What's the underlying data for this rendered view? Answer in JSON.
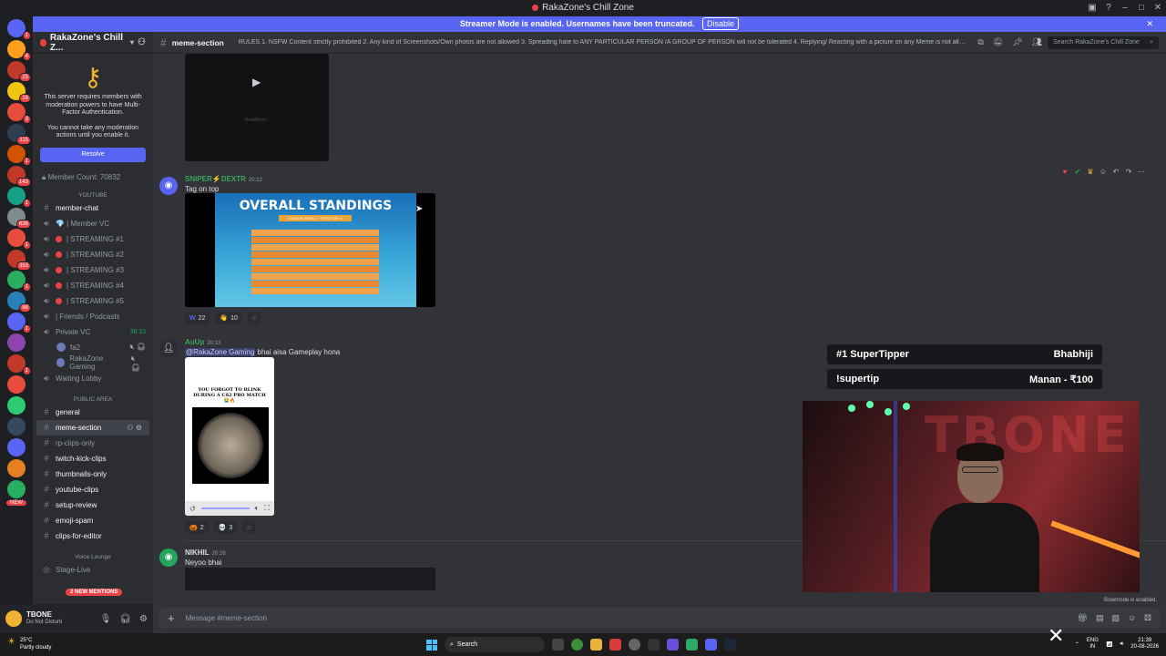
{
  "window": {
    "title": "RakaZone's Chill Zone"
  },
  "banner": {
    "text": "Streamer Mode is enabled. Usernames have been truncated.",
    "button": "Disable"
  },
  "server": {
    "name": "RakaZone's Chill Z..."
  },
  "mfa": {
    "line1": "This server requires members with moderation powers to have Multi-Factor Authentication.",
    "line2": "You cannot take any moderation actions until you enable it.",
    "button": "Resolve"
  },
  "member_count": "Member Count: 70832",
  "categories": {
    "youtube": "YOUTUBE",
    "public": "PUBLIC AREA",
    "voice": "Voice Lounge"
  },
  "youtube_channels": [
    {
      "label": "member-chat"
    },
    {
      "label": "💎 | Member VC"
    },
    {
      "label": "| STREAMING #1"
    },
    {
      "label": "| STREAMING #2"
    },
    {
      "label": "| STREAMING #3"
    },
    {
      "label": "| STREAMING #4"
    },
    {
      "label": "| STREAMING #5"
    },
    {
      "label": "| Friends / Podcasts"
    },
    {
      "label": "Private VC",
      "time": "36:10"
    },
    {
      "label": "fa2"
    },
    {
      "label": "RakaZone Gaming"
    },
    {
      "label": "Waiting Lobby"
    }
  ],
  "public_channels": [
    "general",
    "meme-section",
    "rp-clips-only",
    "twitch-kick-clips",
    "thumbnails-only",
    "youtube-clips",
    "setup-review",
    "emoji-spam",
    "clips-for-editor"
  ],
  "voice_channels": [
    "Stage-Live"
  ],
  "new_mentions": "2 NEW MENTIONS",
  "new_badge": "NEW",
  "user": {
    "name": "TBONE",
    "status": "Do Not Disturb"
  },
  "header": {
    "channel": "meme-section",
    "topic": "RULES 1. NSFW Content strictly prohibited 2. Any kind of Screenshots/Own photos are not allowed 3. Spreading hate to ANY PARTICULAR PERSON /A GROUP OF PERSON will not be tolerated 4. Replying/ Reacting with a picture on any Meme is not allowed. 5. Meme...",
    "search": "Search RakaZone's Chill Zone"
  },
  "messages": [
    {
      "author": "SNIPER⚡DEXTR",
      "time": "20:12",
      "text": "Tag on top",
      "color": "#3ba55c",
      "image_title": "OVERALL STANDINGS",
      "image_sub": "LEAGUE WEEK 2 · POST DAY 4",
      "reactions": [
        {
          "emoji": "W",
          "count": "22"
        },
        {
          "emoji": "👋",
          "count": "10"
        }
      ]
    },
    {
      "author": "AuUp",
      "time": "20:13",
      "mention": "@RakaZone Gaming",
      "text": " bhai aisa Gameplay hona",
      "color": "#3ba55c",
      "meme_text": "YOU FORGOT TO BLINK DURING A CS2 PRO MATCH 😭🔥",
      "reactions": [
        {
          "emoji": "🎃",
          "count": "2"
        },
        {
          "emoji": "💀",
          "count": "3"
        }
      ]
    },
    {
      "author": "NIKHIL",
      "time": "20:26",
      "text": "Neyoo bhai",
      "color": "#dbdee1"
    }
  ],
  "input": {
    "placeholder": "Message #meme-section"
  },
  "slowmode": "Slowmode is enabled.",
  "overlay": {
    "row1": {
      "left": "#1 SuperTipper",
      "right": "Bhabhiji"
    },
    "row2": {
      "left": "!supertip",
      "right": "Manan - ₹100"
    },
    "cam_text": "TBONE"
  },
  "taskbar": {
    "weather_temp": "25°C",
    "weather_desc": "Partly cloudy",
    "search": "Search",
    "lang1": "ENG",
    "lang2": "IN",
    "time": "21:39",
    "date": "20-08-2026"
  },
  "server_badges": [
    "1",
    "4",
    "25",
    "16",
    "3",
    "115",
    "1",
    "143",
    "1",
    "636",
    "1",
    "353",
    "1",
    "88",
    "1",
    "",
    "1"
  ],
  "colors": {
    "accent": "#5865f2",
    "danger": "#ed4245",
    "online": "#23a55a"
  }
}
